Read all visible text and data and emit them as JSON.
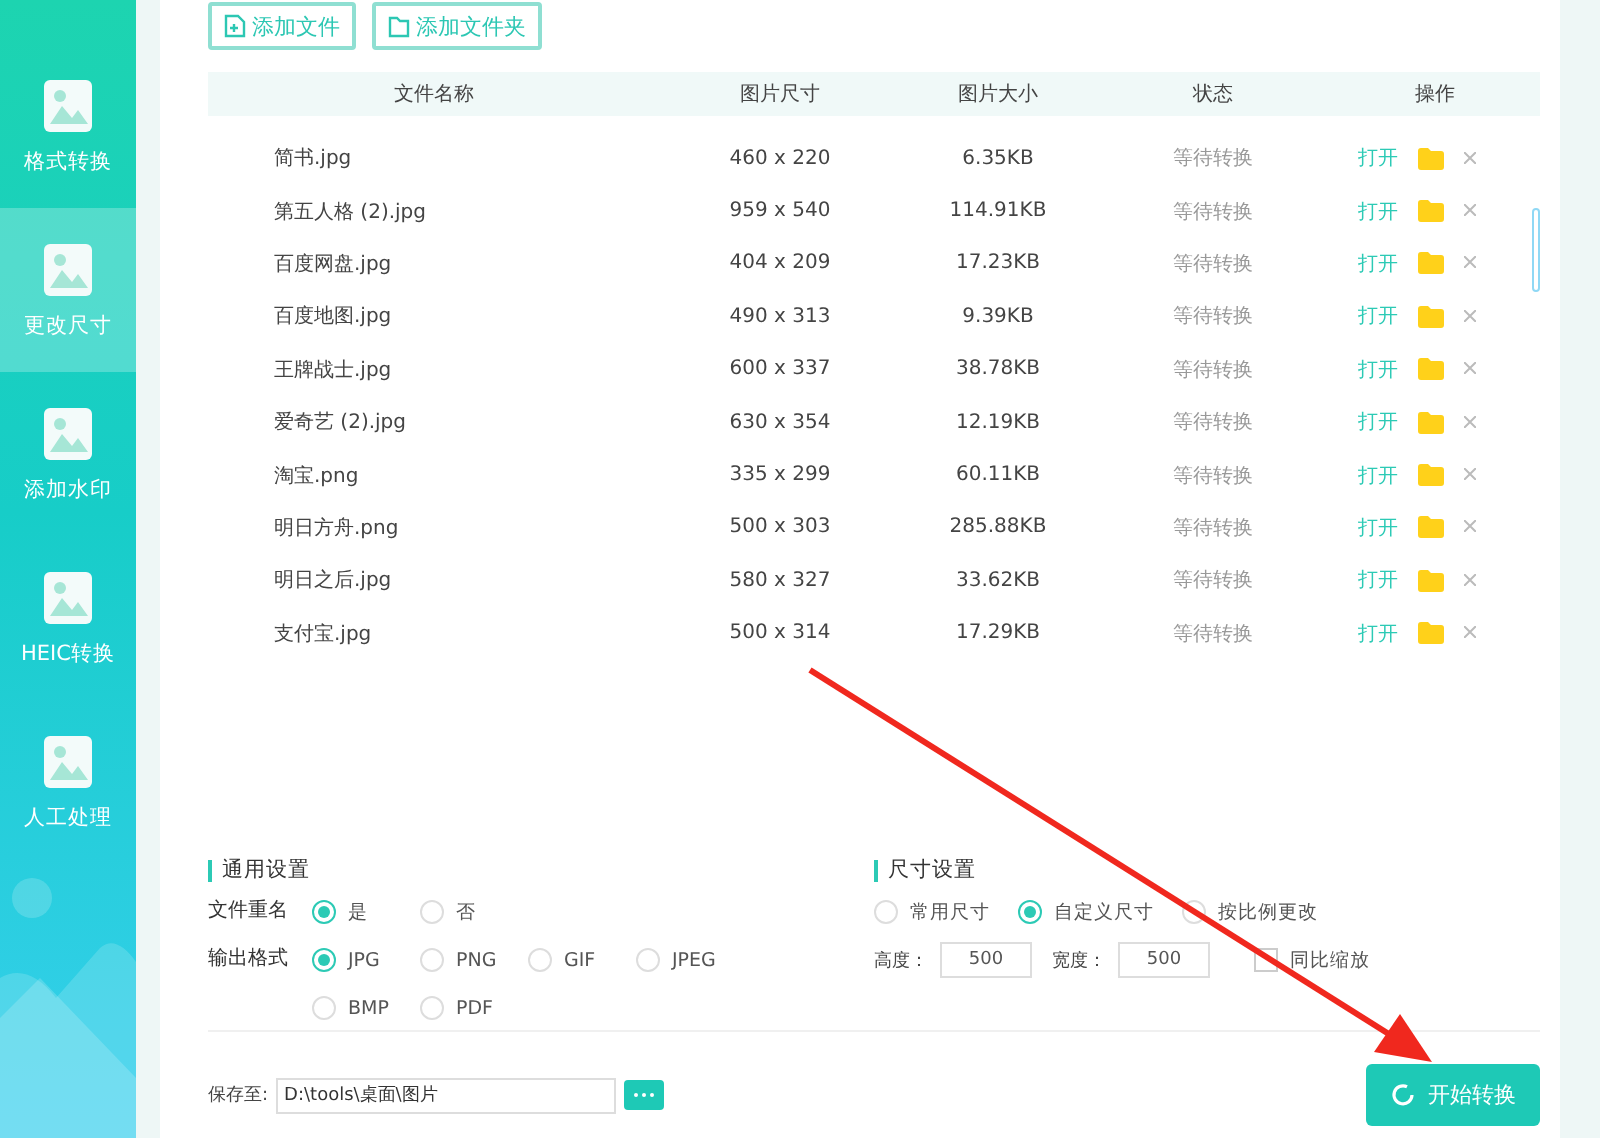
{
  "sidebar": {
    "items": [
      {
        "label": "格式转换",
        "selected": false
      },
      {
        "label": "更改尺寸",
        "selected": true
      },
      {
        "label": "添加水印",
        "selected": false
      },
      {
        "label": "HEIC转换",
        "selected": false
      },
      {
        "label": "人工处理",
        "selected": false
      }
    ]
  },
  "toolbar": {
    "buttons": [
      "添加文件",
      "添加文件夹"
    ]
  },
  "table": {
    "columns": [
      "文件名称",
      "图片尺寸",
      "图片大小",
      "状态",
      "操作"
    ],
    "rows": [
      {
        "name": "简书.jpg",
        "dimensions": "460 x 220",
        "size": "6.35KB",
        "status": "等待转换",
        "open": "打开"
      },
      {
        "name": "第五人格 (2).jpg",
        "dimensions": "959 x 540",
        "size": "114.91KB",
        "status": "等待转换",
        "open": "打开"
      },
      {
        "name": "百度网盘.jpg",
        "dimensions": "404 x 209",
        "size": "17.23KB",
        "status": "等待转换",
        "open": "打开"
      },
      {
        "name": "百度地图.jpg",
        "dimensions": "490 x 313",
        "size": "9.39KB",
        "status": "等待转换",
        "open": "打开"
      },
      {
        "name": "王牌战士.jpg",
        "dimensions": "600 x 337",
        "size": "38.78KB",
        "status": "等待转换",
        "open": "打开"
      },
      {
        "name": "爱奇艺 (2).jpg",
        "dimensions": "630 x 354",
        "size": "12.19KB",
        "status": "等待转换",
        "open": "打开"
      },
      {
        "name": "淘宝.png",
        "dimensions": "335 x 299",
        "size": "60.11KB",
        "status": "等待转换",
        "open": "打开"
      },
      {
        "name": "明日方舟.png",
        "dimensions": "500 x 303",
        "size": "285.88KB",
        "status": "等待转换",
        "open": "打开"
      },
      {
        "name": "明日之后.jpg",
        "dimensions": "580 x 327",
        "size": "33.62KB",
        "status": "等待转换",
        "open": "打开"
      },
      {
        "name": "支付宝.jpg",
        "dimensions": "500 x 314",
        "size": "17.29KB",
        "status": "等待转换",
        "open": "打开"
      }
    ]
  },
  "general_settings": {
    "title": "通用设置",
    "rename": {
      "label": "文件重名",
      "options": [
        {
          "label": "是",
          "selected": true
        },
        {
          "label": "否",
          "selected": false
        }
      ]
    },
    "format": {
      "label": "输出格式",
      "options": [
        {
          "label": "JPG",
          "selected": true
        },
        {
          "label": "PNG",
          "selected": false
        },
        {
          "label": "GIF",
          "selected": false
        },
        {
          "label": "JPEG",
          "selected": false
        },
        {
          "label": "BMP",
          "selected": false
        },
        {
          "label": "PDF",
          "selected": false
        }
      ]
    }
  },
  "size_settings": {
    "title": "尺寸设置",
    "modes": [
      {
        "label": "常用尺寸",
        "selected": false
      },
      {
        "label": "自定义尺寸",
        "selected": true
      },
      {
        "label": "按比例更改",
        "selected": false
      }
    ],
    "height": {
      "label": "高度：",
      "value": "500"
    },
    "width": {
      "label": "宽度：",
      "value": "500"
    },
    "keep_ratio": {
      "label": "同比缩放",
      "checked": false
    }
  },
  "save": {
    "label": "保存至:",
    "path": "D:\\tools\\桌面\\图片"
  },
  "start_button": "开始转换"
}
